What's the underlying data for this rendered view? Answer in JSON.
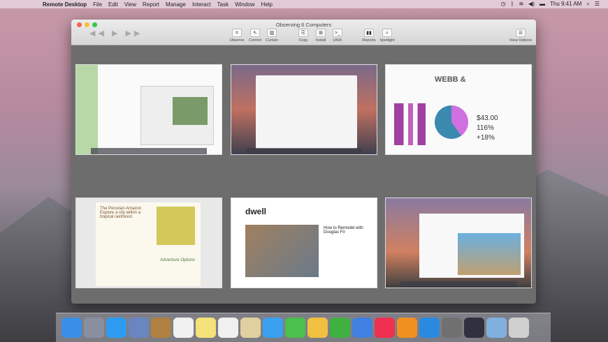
{
  "menubar": {
    "apple": "",
    "app": "Remote Desktop",
    "items": [
      "File",
      "Edit",
      "View",
      "Report",
      "Manage",
      "Interact",
      "Task",
      "Window",
      "Help"
    ],
    "clock": "Thu 9:41 AM"
  },
  "window": {
    "title": "Observing 6 Computers"
  },
  "toolbar": [
    {
      "label": "Observe",
      "icon": "binoculars-icon",
      "glyph": "⌗"
    },
    {
      "label": "Control",
      "icon": "pointer-icon",
      "glyph": "↖"
    },
    {
      "label": "Curtain",
      "icon": "curtain-icon",
      "glyph": "▥"
    },
    {
      "label": "Copy",
      "icon": "copy-icon",
      "glyph": "⎘"
    },
    {
      "label": "Install",
      "icon": "install-icon",
      "glyph": "⊞"
    },
    {
      "label": "UNIX",
      "icon": "terminal-icon",
      "glyph": ">_"
    },
    {
      "label": "Reports",
      "icon": "reports-icon",
      "glyph": "▮▮"
    },
    {
      "label": "Spotlight",
      "icon": "search-icon",
      "glyph": "⌕"
    },
    {
      "label": "View Options",
      "icon": "list-icon",
      "glyph": "☰"
    }
  ],
  "thumbs": [
    {
      "name": "calendar-messages"
    },
    {
      "name": "finder"
    },
    {
      "name": "numbers-report",
      "value1": "$43.00",
      "value2": "116%",
      "value3": "+18%"
    },
    {
      "name": "pages-document",
      "heading": "The Peruvian Amazon Explore a city within a tropical rainforest",
      "sub": "Adventure Options"
    },
    {
      "name": "dwell-website",
      "logo": "dwell",
      "headline": "How to Remodel with Douglas Fir"
    },
    {
      "name": "mail-photo"
    }
  ],
  "dock_colors": [
    "#3a8ee6",
    "#8a8fa0",
    "#2d9cf0",
    "#6a86c0",
    "#b08040",
    "#f0f0f0",
    "#f4e27a",
    "#f0f0f0",
    "#e0d0a0",
    "#3aa0f0",
    "#4cc04c",
    "#f0c040",
    "#40b040",
    "#4080e0",
    "#f03050",
    "#f09020",
    "#2a8ae0",
    "#707070",
    "#303040",
    "#80b0e0",
    "#d0d0d0"
  ]
}
